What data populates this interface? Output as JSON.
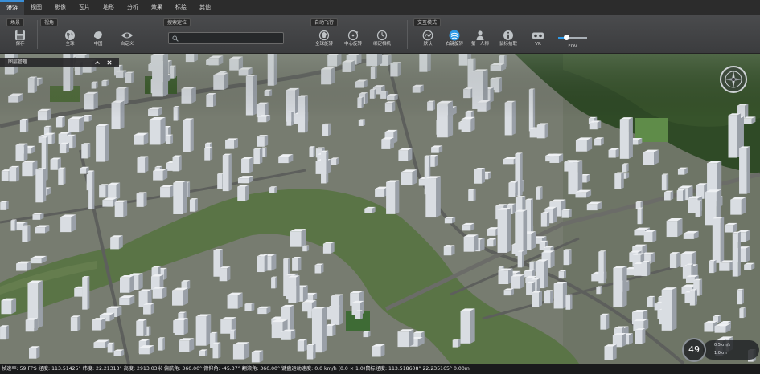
{
  "menu": {
    "tabs": [
      "漫游",
      "视图",
      "影像",
      "瓦片",
      "地形",
      "分析",
      "效果",
      "标绘",
      "其他"
    ],
    "active_index": 0
  },
  "ribbon": {
    "scene_group": {
      "title": "场景",
      "save_label": "保存",
      "save_icon": "save-icon"
    },
    "view_group": {
      "title": "视角",
      "items": [
        {
          "label": "全球",
          "icon": "globe-icon"
        },
        {
          "label": "中国",
          "icon": "china-map-icon"
        },
        {
          "label": "自定义",
          "icon": "eye-icon"
        }
      ]
    },
    "search_group": {
      "title": "搜索定位",
      "value": "",
      "placeholder": ""
    },
    "flight_group": {
      "title": "自动飞行",
      "items": [
        {
          "label": "全球旋转",
          "icon": "globe-rotate-icon"
        },
        {
          "label": "中心旋转",
          "icon": "center-rotate-icon"
        },
        {
          "label": "绑定相机",
          "icon": "camera-bind-icon"
        }
      ]
    },
    "interaction_group": {
      "title": "交互模式",
      "items": [
        {
          "label": "默认",
          "icon": "default-mode-icon"
        },
        {
          "label": "右键旋转",
          "icon": "right-rotate-icon"
        },
        {
          "label": "第一人称",
          "icon": "first-person-icon"
        },
        {
          "label": "鼠标拾取",
          "icon": "info-icon"
        },
        {
          "label": "VR",
          "icon": "vr-icon"
        }
      ],
      "active_index": 1,
      "fov_label": "FOV",
      "fov_value": 0.28
    }
  },
  "layer_panel": {
    "title": "图层管理"
  },
  "gauge": {
    "value": "49",
    "row1": "0.5km/s",
    "row2": "1.0km"
  },
  "statusbar": {
    "text": "帧速率: 59 FPS 经度: 113.51425° 纬度: 22.21313° 高度: 2913.03米 偏航角: 360.00° 俯仰角: -45.37° 翻滚角: 360.00° 键盘运动速度: 0.0 km/h (0.0 × 1.0)鼠标经度: 113.518608° 22.235165° 0.00m"
  },
  "colors": {
    "accent": "#2f9be8",
    "menubar": "#2c2c2c",
    "ribbon": "#434446",
    "river": "#5a7446"
  }
}
